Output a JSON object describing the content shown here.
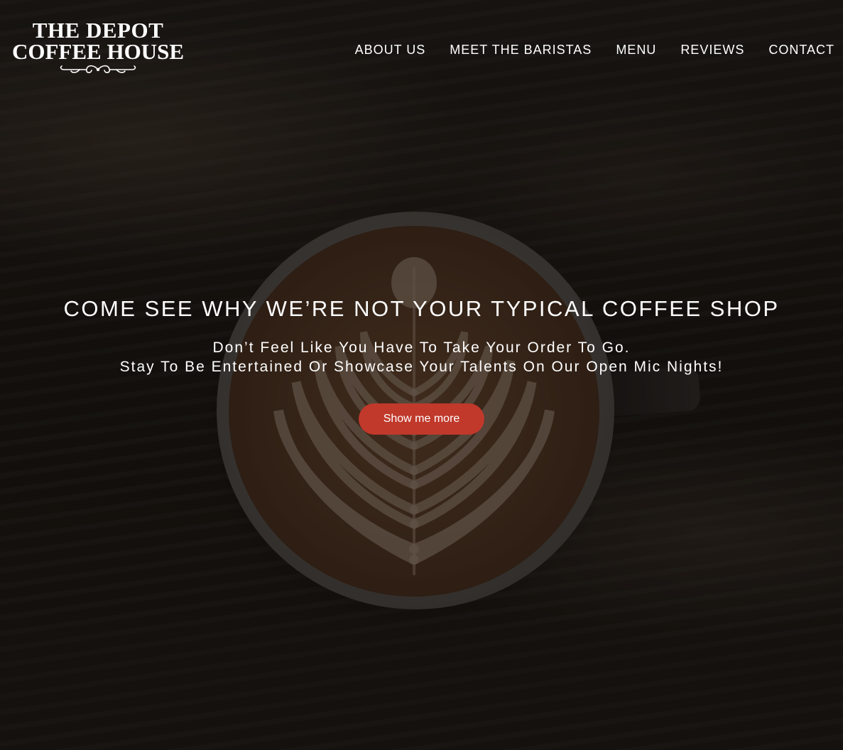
{
  "brand": {
    "line1": "THE DEPOT",
    "line2": "COFFEE HOUSE"
  },
  "nav": {
    "items": [
      {
        "label": "ABOUT US"
      },
      {
        "label": "MEET THE BARISTAS"
      },
      {
        "label": "MENU"
      },
      {
        "label": "REVIEWS"
      },
      {
        "label": "CONTACT"
      }
    ]
  },
  "hero": {
    "headline": "COME SEE WHY WE’RE NOT YOUR TYPICAL COFFEE SHOP",
    "subline1": "Don’t Feel Like You Have To Take Your Order To Go.",
    "subline2": "Stay To Be Entertained Or Showcase Your Talents On Our Open Mic Nights!",
    "cta_label": "Show me more"
  },
  "colors": {
    "accent": "#c0392b",
    "text": "#ffffff",
    "background": "#16120f"
  }
}
